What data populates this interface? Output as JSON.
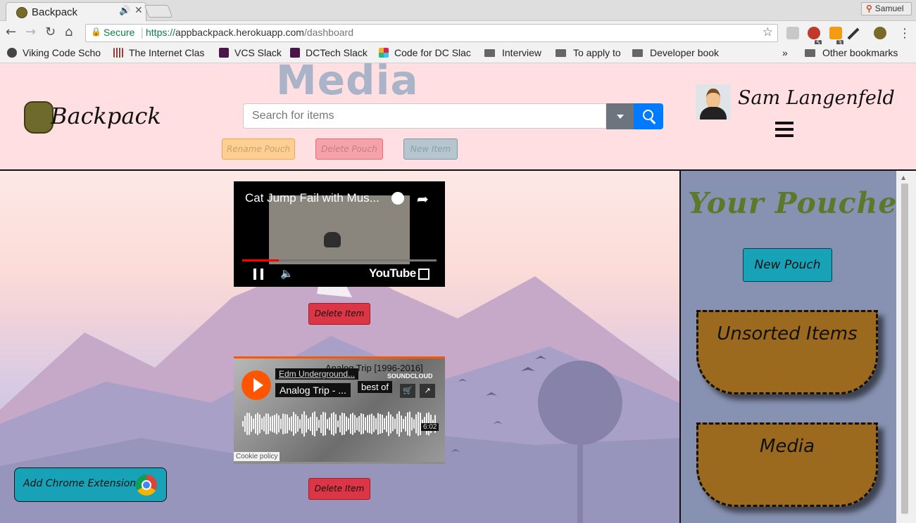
{
  "browser": {
    "tab_title": "Backpack",
    "tab_audio_icon": "speaker-icon",
    "profile_name": "Samuel",
    "secure_label": "Secure",
    "url_scheme": "https://",
    "url_host": "appbackpack.herokuapp.com",
    "url_path": "/dashboard",
    "ext_badges": [
      "5",
      "3"
    ],
    "bookmarks": [
      {
        "label": "Viking Code Scho",
        "icon": "viking-icon"
      },
      {
        "label": "The Internet Clas",
        "icon": "bars-icon"
      },
      {
        "label": "VCS Slack",
        "icon": "slack-hash-icon"
      },
      {
        "label": "DCTech Slack",
        "icon": "slack-hash-icon"
      },
      {
        "label": "Code for DC Slac",
        "icon": "slack-icon"
      },
      {
        "label": "Interview",
        "icon": "folder-icon"
      },
      {
        "label": "To apply to",
        "icon": "folder-icon"
      },
      {
        "label": "Developer book",
        "icon": "folder-icon"
      }
    ],
    "overflow_chevron": "»",
    "other_bookmarks": "Other bookmarks"
  },
  "header": {
    "logo_text": "Backpack",
    "page_heading": "Media",
    "search_placeholder": "Search for items",
    "rename_pouch": "Rename Pouch",
    "delete_pouch": "Delete Pouch",
    "new_item": "New Item",
    "user_name": "Sam Langenfeld"
  },
  "items": {
    "youtube": {
      "title": "Cat Jump Fail with Mus...",
      "logo": "YouTube",
      "progress": 0.19
    },
    "soundcloud": {
      "uploader": "Edm Underground...",
      "track": "Analog Trip - ...",
      "best_of": "best of",
      "album": "Analog Trip [1996-2016]",
      "brand": "SOUNDCLOUD",
      "duration": "6:02",
      "cookie": "Cookie policy"
    },
    "delete_label": "Delete Item"
  },
  "chrome_extension": {
    "label": "Add Chrome Extension"
  },
  "sidebar": {
    "title": "Your Pouches",
    "new_pouch": "New Pouch",
    "pouches": [
      "Unsorted Items",
      "Media"
    ]
  },
  "colors": {
    "header_bg": "#ffdfe1",
    "sidebar_bg": "#8792b2",
    "pouch": "#9b6a1f",
    "accent_teal": "#17a2b8",
    "danger": "#dc3545",
    "primary": "#007bff"
  }
}
